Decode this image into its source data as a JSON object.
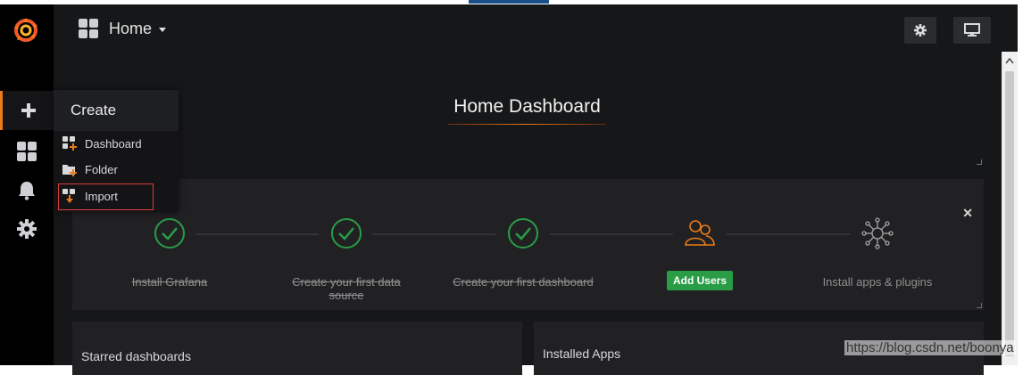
{
  "topbar": {
    "home_label": "Home"
  },
  "dashboard": {
    "title": "Home Dashboard"
  },
  "create_menu": {
    "header": "Create",
    "items": [
      {
        "label": "Dashboard",
        "icon": "dashboard-add-icon"
      },
      {
        "label": "Folder",
        "icon": "folder-add-icon"
      },
      {
        "label": "Import",
        "icon": "import-icon"
      }
    ]
  },
  "getting_started": {
    "steps": [
      {
        "label": "Install Grafana",
        "status": "done"
      },
      {
        "label": "Create your first data source",
        "status": "done"
      },
      {
        "label": "Create your first dashboard",
        "status": "done"
      },
      {
        "label": "Add Users",
        "status": "active"
      },
      {
        "label": "Install apps & plugins",
        "status": "pending"
      }
    ]
  },
  "panels": {
    "starred": "Starred dashboards",
    "installed_apps": "Installed Apps"
  },
  "watermark": "https://blog.csdn.net/boonya",
  "colors": {
    "accent_orange": "#eb7b18",
    "success_green": "#299c46",
    "bg_dark": "#161719",
    "panel_bg": "#212124"
  }
}
